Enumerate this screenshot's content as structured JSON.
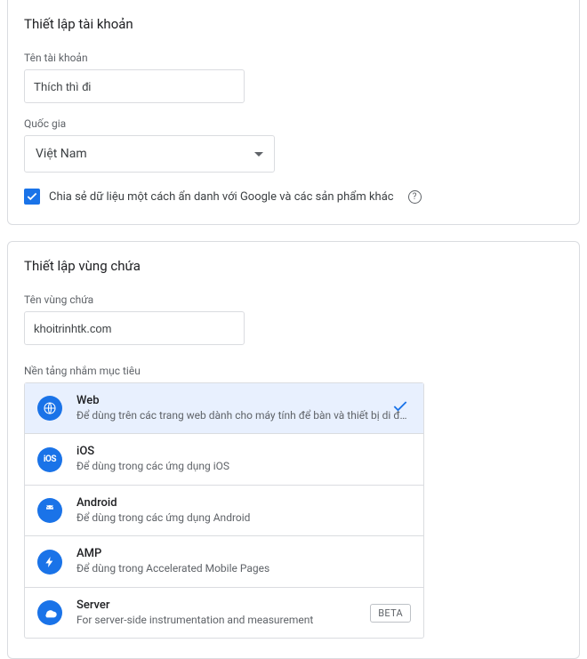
{
  "account": {
    "section_title": "Thiết lập tài khoản",
    "name_label": "Tên tài khoản",
    "name_value": "Thích thì đi",
    "country_label": "Quốc gia",
    "country_value": "Việt Nam",
    "share_checkbox_label": "Chia sẻ dữ liệu một cách ẩn danh với Google và các sản phẩm khác"
  },
  "container": {
    "section_title": "Thiết lập vùng chứa",
    "name_label": "Tên vùng chứa",
    "name_value": "khoitrinhtk.com",
    "platform_label": "Nền tảng nhắm mục tiêu",
    "beta_label": "BETA",
    "platforms": [
      {
        "title": "Web",
        "desc": "Để dùng trên các trang web dành cho máy tính để bàn và thiết bị di động"
      },
      {
        "title": "iOS",
        "desc": "Để dùng trong các ứng dụng iOS"
      },
      {
        "title": "Android",
        "desc": "Để dùng trong các ứng dụng Android"
      },
      {
        "title": "AMP",
        "desc": "Để dùng trong Accelerated Mobile Pages"
      },
      {
        "title": "Server",
        "desc": "For server-side instrumentation and measurement"
      }
    ]
  }
}
